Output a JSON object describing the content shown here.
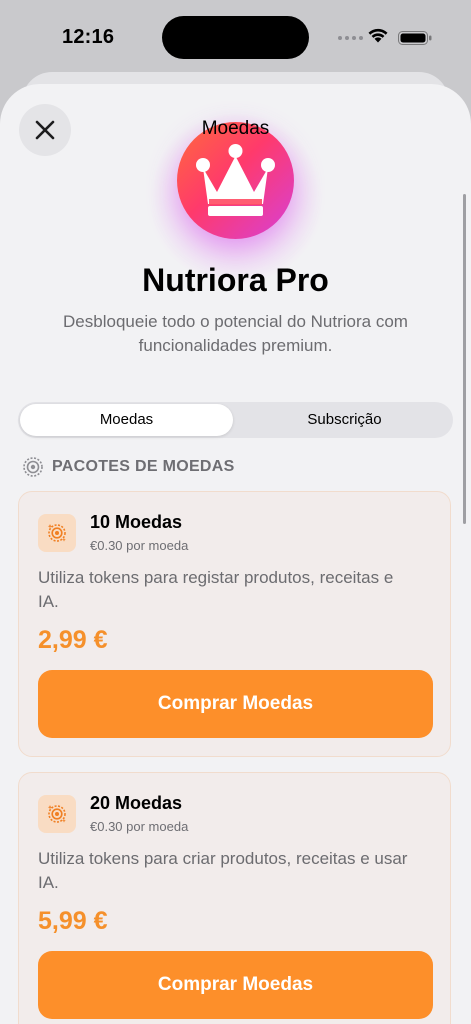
{
  "status_bar": {
    "time": "12:16"
  },
  "nav": {
    "title": "Moedas"
  },
  "hero": {
    "title": "Nutriora Pro",
    "subtitle": "Desbloqueie todo o potencial do Nutriora com funcionalidades premium."
  },
  "tabs": [
    {
      "label": "Moedas",
      "selected": true
    },
    {
      "label": "Subscrição",
      "selected": false
    }
  ],
  "section": {
    "title": "PACOTES DE MOEDAS"
  },
  "packages": [
    {
      "name": "10 Moedas",
      "rate": "€0.30 por moeda",
      "description": "Utiliza tokens para registar produtos, receitas e IA.",
      "price": "2,99 €",
      "button": "Comprar Moedas"
    },
    {
      "name": "20 Moedas",
      "rate": "€0.30 por moeda",
      "description": "Utiliza tokens para criar produtos, receitas e usar IA.",
      "price": "5,99 €",
      "button": "Comprar Moedas"
    }
  ],
  "colors": {
    "accent": "#fd8f2a",
    "price": "#f5902b",
    "crown_gradient_start": "#ff6a3c",
    "crown_gradient_end": "#d640d8"
  },
  "icons": [
    "close-icon",
    "crown-icon",
    "coin-target-icon",
    "wifi-icon",
    "battery-icon"
  ]
}
